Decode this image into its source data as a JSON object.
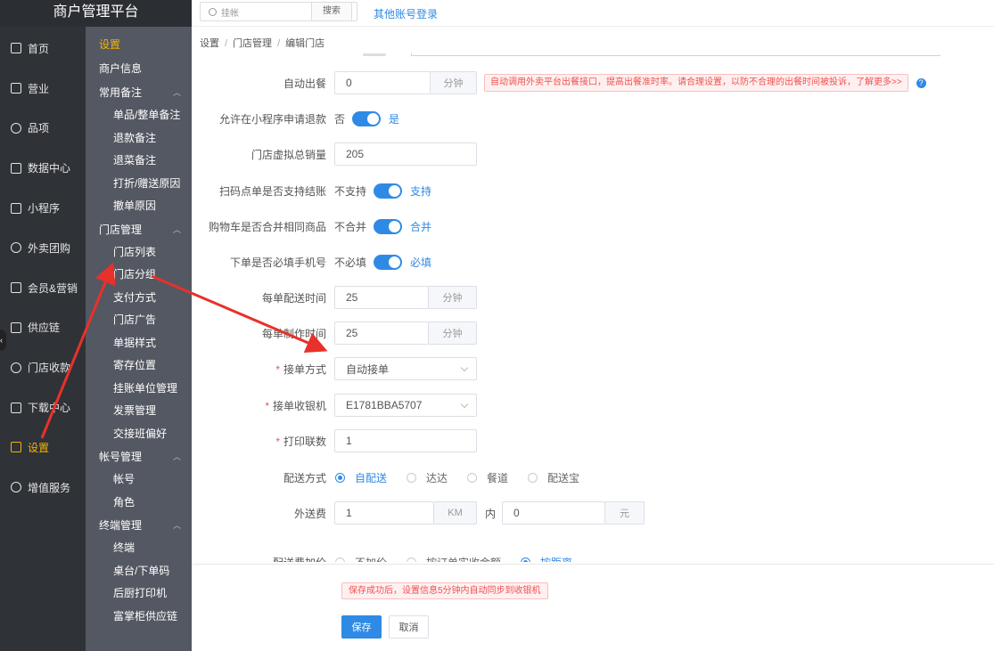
{
  "brand": "商户管理平台",
  "nav": [
    {
      "label": "首页",
      "icon": "doc-icon"
    },
    {
      "label": "营业",
      "icon": "calendar-icon"
    },
    {
      "label": "品项",
      "icon": "bag-icon"
    },
    {
      "label": "数据中心",
      "icon": "share-icon"
    },
    {
      "label": "小程序",
      "icon": "phone-icon"
    },
    {
      "label": "外卖团购",
      "icon": "bike-icon"
    },
    {
      "label": "会员&营销",
      "icon": "user-icon"
    },
    {
      "label": "供应链",
      "icon": "truck-icon"
    },
    {
      "label": "门店收款",
      "icon": "database-icon"
    },
    {
      "label": "下载中心",
      "icon": "download-icon"
    },
    {
      "label": "设置",
      "icon": "gear-icon",
      "active": true
    },
    {
      "label": "增值服务",
      "icon": "clock-icon"
    }
  ],
  "subnav": {
    "head": "设置",
    "merchant_info": "商户信息",
    "groups": [
      {
        "title": "常用备注",
        "items": [
          "单品/整单备注",
          "退款备注",
          "退菜备注",
          "打折/赠送原因",
          "撤单原因"
        ]
      },
      {
        "title": "门店管理",
        "items": [
          "门店列表",
          "门店分组",
          "支付方式",
          "门店广告",
          "单据样式",
          "寄存位置",
          "挂账单位管理",
          "发票管理",
          "交接班偏好"
        ]
      },
      {
        "title": "帐号管理",
        "items": [
          "帐号",
          "角色"
        ]
      },
      {
        "title": "终端管理",
        "items": [
          "终端",
          "桌台/下单码",
          "后厨打印机",
          "富掌柜供应链"
        ]
      }
    ]
  },
  "topbar": {
    "search_value": "挂帐",
    "search_button": "搜索",
    "other_login": "其他账号登录"
  },
  "breadcrumb": [
    "设置",
    "门店管理",
    "编辑门店"
  ],
  "form": {
    "auto_serve": {
      "label": "自动出餐",
      "value": "0",
      "unit": "分钟",
      "warning": "自动调用外卖平台出餐接口，提高出餐准时率。请合理设置，以防不合理的出餐时间被投诉，了解更多>>"
    },
    "refund": {
      "label": "允许在小程序申请退款",
      "off": "否",
      "on": "是"
    },
    "virtual_sales": {
      "label": "门店虚拟总销量",
      "value": "205"
    },
    "scan_checkout": {
      "label": "扫码点单是否支持结账",
      "off": "不支持",
      "on": "支持"
    },
    "merge_cart": {
      "label": "购物车是否合并相同商品",
      "off": "不合并",
      "on": "合并"
    },
    "phone_required": {
      "label": "下单是否必填手机号",
      "off": "不必填",
      "on": "必填"
    },
    "delivery_time": {
      "label": "每单配送时间",
      "value": "25",
      "unit": "分钟"
    },
    "make_time": {
      "label": "每单制作时间",
      "value": "25",
      "unit": "分钟"
    },
    "accept_mode": {
      "label": "接单方式",
      "value": "自动接单"
    },
    "accept_cashier": {
      "label": "接单收银机",
      "value": "E1781BBA5707"
    },
    "print_copies": {
      "label": "打印联数",
      "value": "1"
    },
    "delivery_mode": {
      "label": "配送方式",
      "options": [
        "自配送",
        "达达",
        "餐道",
        "配送宝"
      ],
      "selected": "自配送"
    },
    "delivery_fee": {
      "label": "外送费",
      "distance": "1",
      "distance_unit": "KM",
      "within": "内",
      "fee": "0",
      "fee_unit": "元"
    },
    "fee_markup": {
      "label": "配送费加价",
      "options": [
        "不加价",
        "按订单实收金额",
        "按距离"
      ],
      "selected": "按距离"
    }
  },
  "footer": {
    "success_msg": "保存成功后，设置信息5分钟内自动同步到收银机",
    "save": "保存",
    "cancel": "取消"
  },
  "colors": {
    "accent": "#2f8ae5",
    "active_nav": "#f5b400",
    "warning": "#f0524f",
    "annotation_arrow": "#e8312a"
  }
}
